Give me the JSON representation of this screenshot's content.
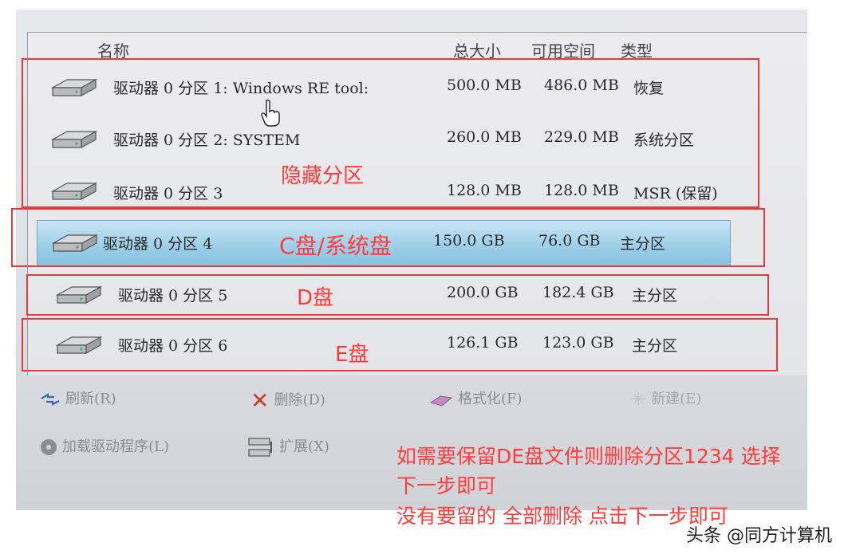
{
  "columns": {
    "name": "名称",
    "total_size": "总大小",
    "free_space": "可用空间",
    "type": "类型"
  },
  "partitions": [
    {
      "name": "驱动器 0 分区 1: Windows RE tool:",
      "total": "500.0 MB",
      "free": "486.0 MB",
      "type": "恢复"
    },
    {
      "name": "驱动器 0 分区 2: SYSTEM",
      "total": "260.0 MB",
      "free": "229.0 MB",
      "type": "系统分区"
    },
    {
      "name": "驱动器 0 分区 3",
      "total": "128.0 MB",
      "free": "128.0 MB",
      "type": "MSR (保留)"
    },
    {
      "name": "驱动器 0 分区 4",
      "total": "150.0 GB",
      "free": "76.0 GB",
      "type": "主分区",
      "selected": true
    },
    {
      "name": "驱动器 0 分区 5",
      "total": "200.0 GB",
      "free": "182.4 GB",
      "type": "主分区"
    },
    {
      "name": "驱动器 0 分区 6",
      "total": "126.1 GB",
      "free": "123.0 GB",
      "type": "主分区"
    }
  ],
  "actions": {
    "refresh": "刷新(R)",
    "delete": "删除(D)",
    "format": "格式化(F)",
    "new": "新建(E)",
    "load_driver": "加载驱动程序(L)",
    "extend": "扩展(X)"
  },
  "annotations": {
    "hidden": "隐藏分区",
    "c_drive": "C盘/系统盘",
    "d_drive": "D盘",
    "e_drive": "E盘",
    "note_line1": "如需要保留DE盘文件则删除分区1234 选择",
    "note_line2": "下一步即可",
    "note_line3": "没有要留的 全部删除 点击下一步即可"
  },
  "watermark": "头条 @同方计算机",
  "colors": {
    "annotation_red": "#ff3b3b",
    "selected_row": "#9fd0e8"
  }
}
